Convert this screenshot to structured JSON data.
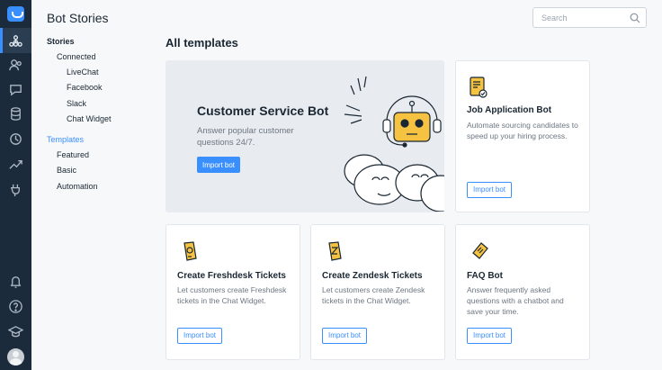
{
  "app": {
    "title": "Bot Stories"
  },
  "search": {
    "placeholder": "Search"
  },
  "rail": {
    "items": [
      "bots-icon",
      "customers-icon",
      "chats-icon",
      "archives-icon",
      "history-icon",
      "reports-icon",
      "integrations-icon"
    ],
    "bottom": [
      "bell-icon",
      "help-icon",
      "academy-icon"
    ]
  },
  "sidebar": {
    "stories": "Stories",
    "connected": "Connected",
    "channels": [
      "LiveChat",
      "Facebook",
      "Slack",
      "Chat Widget"
    ],
    "templates": "Templates",
    "template_groups": [
      "Featured",
      "Basic",
      "Automation"
    ]
  },
  "main": {
    "section_title": "All templates",
    "hero": {
      "title": "Customer Service Bot",
      "description": "Answer popular customer questions 24/7.",
      "button": "Import bot"
    },
    "cards": [
      {
        "title": "Job Application Bot",
        "description": "Automate sourcing candidates to speed up your hiring process.",
        "button": "Import bot",
        "icon": "document-icon"
      },
      {
        "title": "Create Freshdesk Tickets",
        "description": "Let customers create Freshdesk tickets in the Chat Widget.",
        "button": "Import bot",
        "icon": "ticket-icon"
      },
      {
        "title": "Create Zendesk Tickets",
        "description": "Let customers create Zendesk tickets in the Chat Widget.",
        "button": "Import bot",
        "icon": "ticket-icon"
      },
      {
        "title": "FAQ Bot",
        "description": "Answer frequently asked questions with a chatbot and save your time.",
        "button": "Import bot",
        "icon": "ticket-icon"
      }
    ]
  },
  "colors": {
    "accent": "#3a8fff",
    "rail": "#1b2b3c",
    "yellow": "#f5c242"
  }
}
